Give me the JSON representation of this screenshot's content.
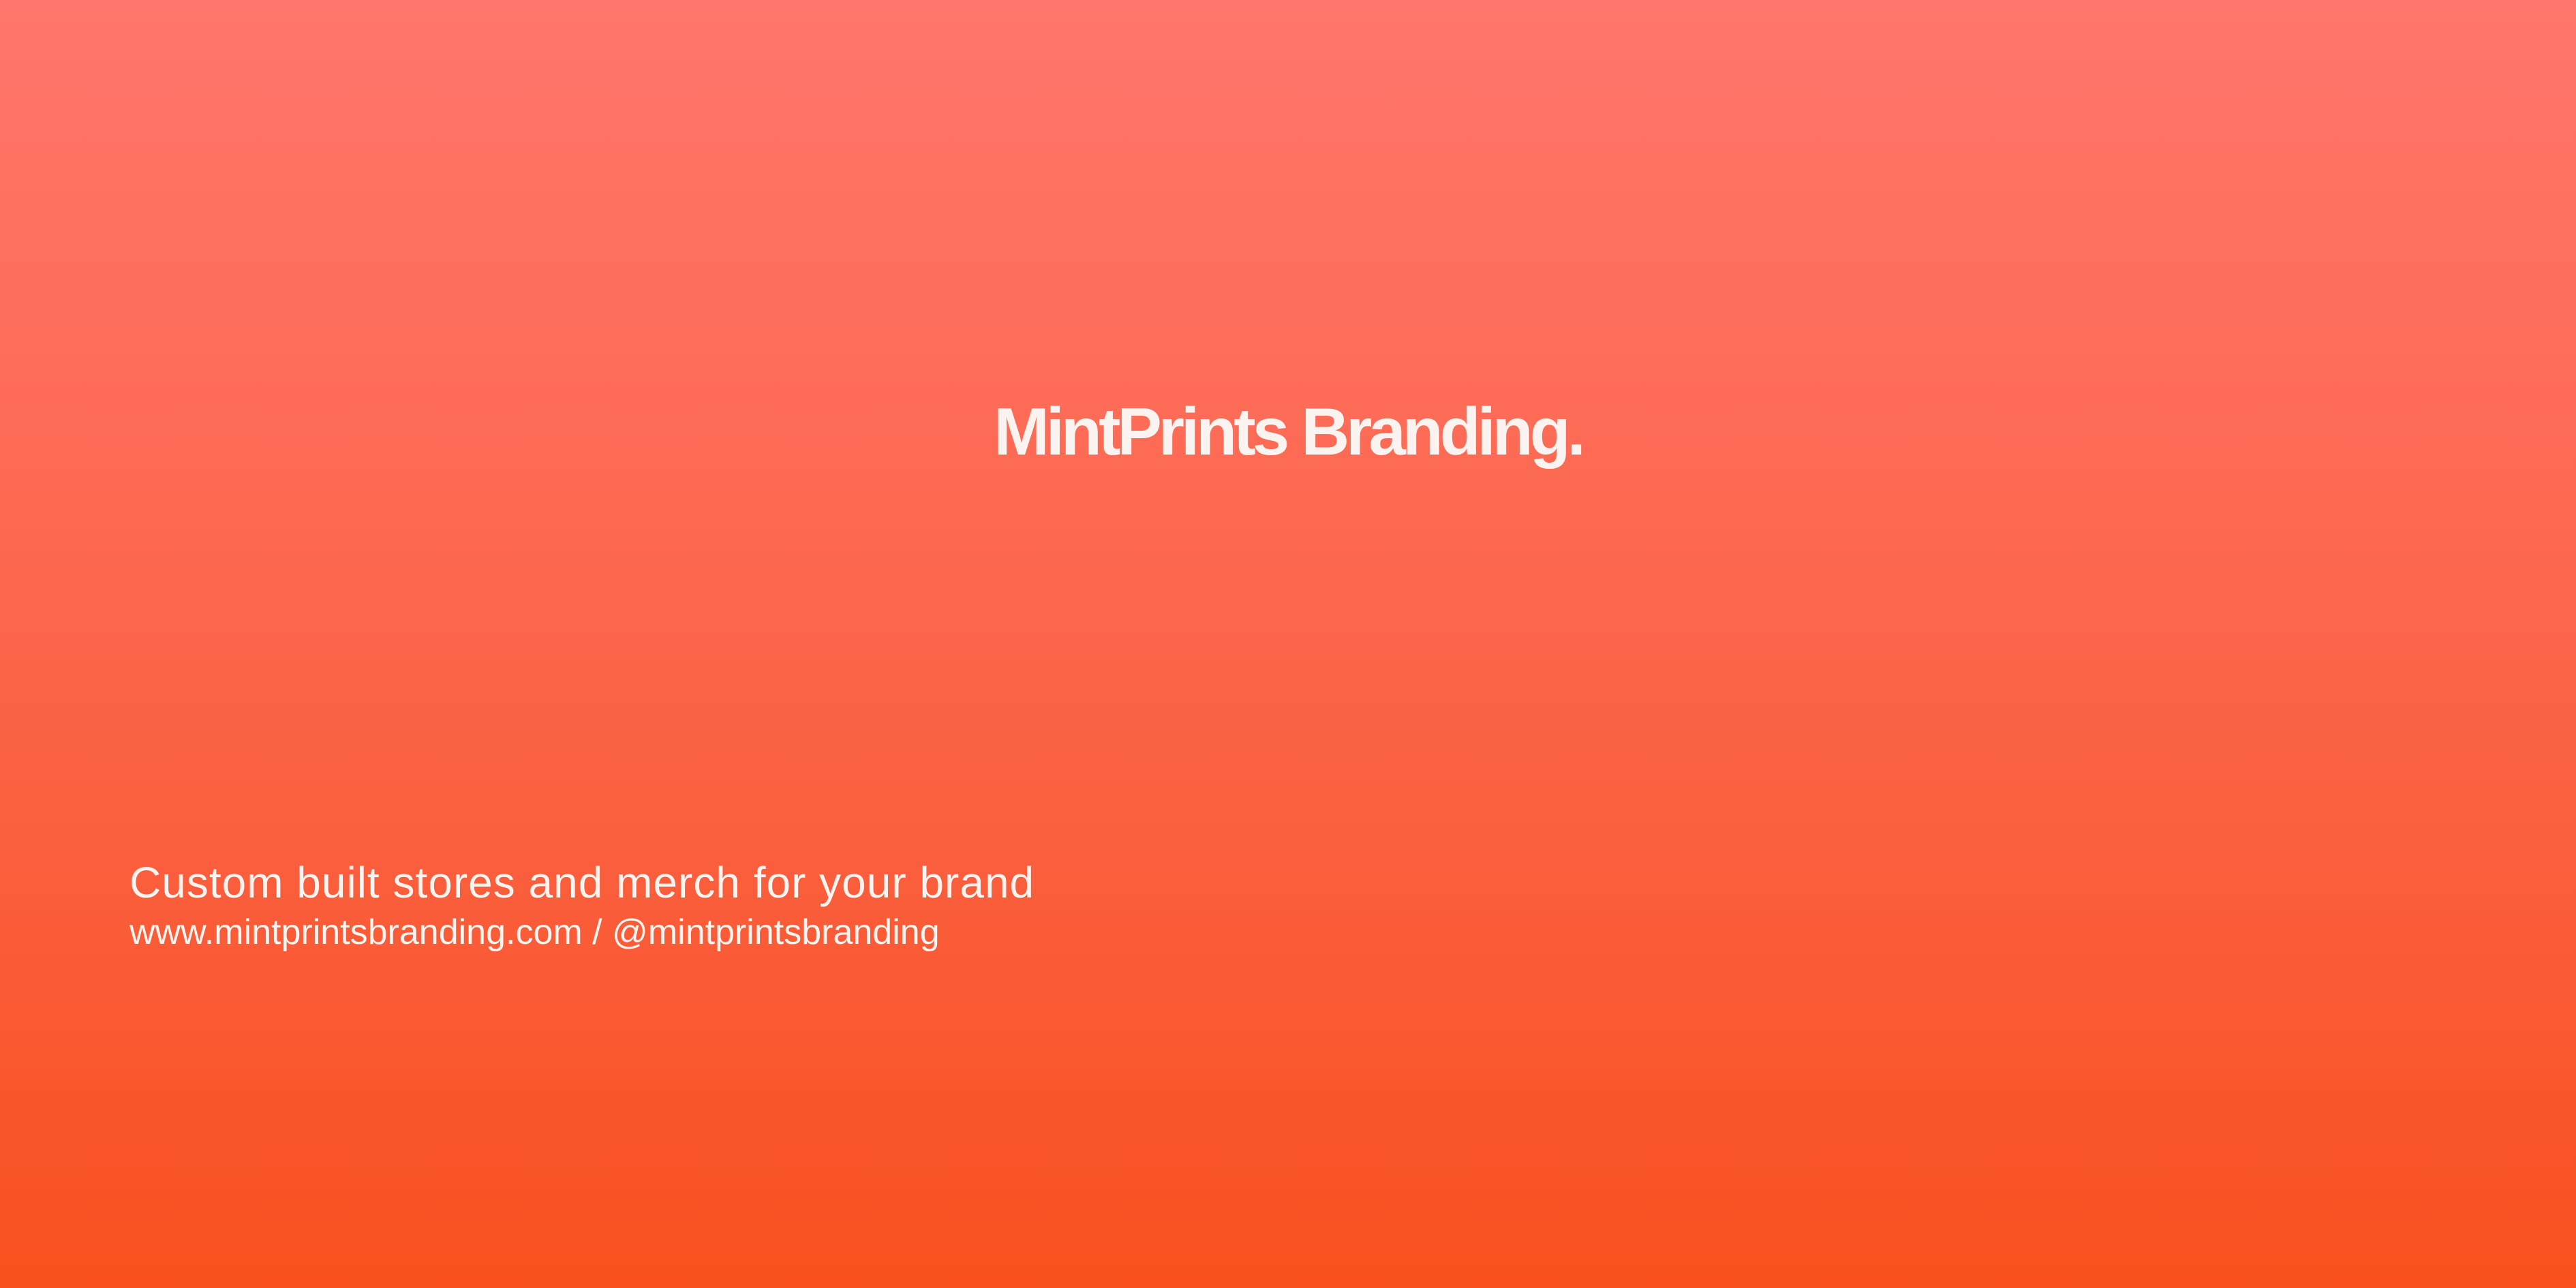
{
  "brand": {
    "title": "MintPrints Branding."
  },
  "footer": {
    "tagline": "Custom built stores and merch for your brand",
    "contact": "www.mintprintsbranding.com / @mintprintsbranding"
  },
  "colors": {
    "gradient_top": "#FF766C",
    "gradient_bottom": "#F9501E",
    "text": "#FAF3EF"
  }
}
